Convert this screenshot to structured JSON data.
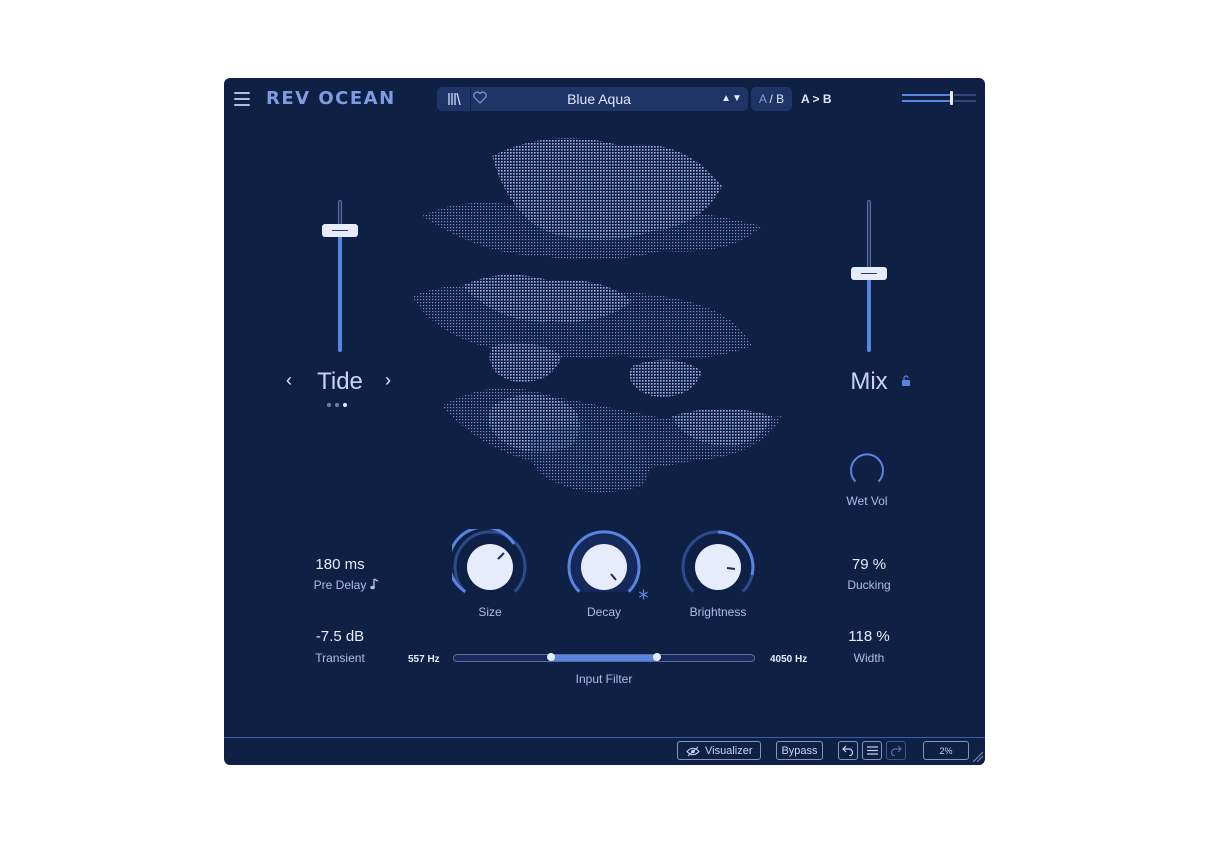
{
  "header": {
    "app_title": "REV OCEAN",
    "preset_name": "Blue Aqua",
    "preset_nav_arrows": "▲▼",
    "ab_a": "A",
    "ab_sep": " / ",
    "ab_b": "B",
    "a_to_b": "A > B",
    "output_level": 0.68
  },
  "left_slider": {
    "label": "Tide",
    "prev_arrow": "‹",
    "next_arrow": "›",
    "level": 0.83,
    "page_dots": 3,
    "active_dot": 2
  },
  "right_slider": {
    "label": "Mix",
    "level": 0.52
  },
  "wet_vol": {
    "label": "Wet Vol"
  },
  "params": {
    "pre_delay": {
      "value": "180 ms",
      "label": "Pre Delay"
    },
    "transient": {
      "value": "-7.5 dB",
      "label": "Transient"
    },
    "ducking": {
      "value": "79 %",
      "label": "Ducking"
    },
    "width": {
      "value": "118 %",
      "label": "Width"
    }
  },
  "knobs": {
    "size": {
      "label": "Size"
    },
    "decay": {
      "label": "Decay"
    },
    "brightness": {
      "label": "Brightness"
    }
  },
  "input_filter": {
    "label": "Input Filter",
    "low": "557 Hz",
    "high": "4050 Hz"
  },
  "footer": {
    "visualizer": "Visualizer",
    "bypass": "Bypass",
    "zoom": "2%"
  },
  "colors": {
    "background": "#0f2045",
    "accent": "#5b84e0",
    "accent_text": "#7f9ce3",
    "light": "#e6ecfb"
  }
}
